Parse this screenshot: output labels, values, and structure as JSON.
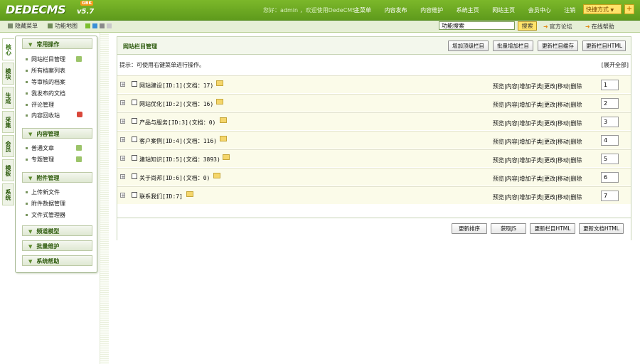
{
  "brand": {
    "logo": "DEDECMS",
    "version": "v5.7",
    "badge": "GBK"
  },
  "header": {
    "welcome": "您好：admin ，欢迎使用DedeCMS！",
    "nav": [
      "主菜单",
      "内容发布",
      "内容维护",
      "系统主页",
      "网站主页",
      "会员中心",
      "注销"
    ],
    "quick_label": "快捷方式",
    "quick_plus": "+"
  },
  "subbar": {
    "hide_menu": "隐藏菜单",
    "func_map": "功能地图",
    "search_value": "功能搜索",
    "search_button": "搜索",
    "forum": "官方论坛",
    "help": "在线帮助",
    "swatch_colors": [
      "#7cbf2e",
      "#3a8fd6",
      "#8a8a8a",
      "#c8c8c8"
    ]
  },
  "vtabs": [
    "核心",
    "模块",
    "生成",
    "采集",
    "会员",
    "模板",
    "系统"
  ],
  "menu": {
    "groups": [
      {
        "title": "常用操作",
        "items": [
          {
            "label": "网站栏目管理",
            "action": "add"
          },
          {
            "label": "所有档案列表"
          },
          {
            "label": "等审核的档案"
          },
          {
            "label": "我发布的文档"
          },
          {
            "label": "评论管理"
          },
          {
            "label": "内容回收站",
            "action": "trash"
          }
        ]
      },
      {
        "title": "内容管理",
        "items": [
          {
            "label": "普通文章",
            "action": "add"
          },
          {
            "label": "专题管理",
            "action": "add"
          }
        ]
      },
      {
        "title": "附件管理",
        "items": [
          {
            "label": "上传新文件"
          },
          {
            "label": "附件数据管理"
          },
          {
            "label": "文件式管理器"
          }
        ]
      },
      {
        "title": "频道模型",
        "items": []
      },
      {
        "title": "批量维护",
        "items": []
      },
      {
        "title": "系统帮助",
        "items": []
      }
    ]
  },
  "main": {
    "title": "网站栏目管理",
    "top_buttons": [
      "增加顶级栏目",
      "批量增加栏目",
      "更新栏目缓存",
      "更新栏目HTML"
    ],
    "tip": "提示：可使用右键菜单进行操作。",
    "expand_all": "[展开全部]",
    "ops": "预览|内容|增加子类|更改|移动|删除",
    "rows": [
      {
        "name": "网站建设[ID:1](文档：17)",
        "order": "1"
      },
      {
        "name": "网站优化[ID:2](文档：16)",
        "order": "2"
      },
      {
        "name": "产品与服务[ID:3](文档：0)",
        "order": "3"
      },
      {
        "name": "客户案例[ID:4](文档：116)",
        "order": "4"
      },
      {
        "name": "建站知识[ID:5](文档：3893)",
        "order": "5"
      },
      {
        "name": "关于尚邦[ID:6](文档：0)",
        "order": "6"
      },
      {
        "name": "联系我们[ID:7]",
        "order": "7"
      }
    ],
    "bottom_buttons": [
      "更新排序",
      "获取JS",
      "更新栏目HTML",
      "更新文档HTML"
    ]
  }
}
